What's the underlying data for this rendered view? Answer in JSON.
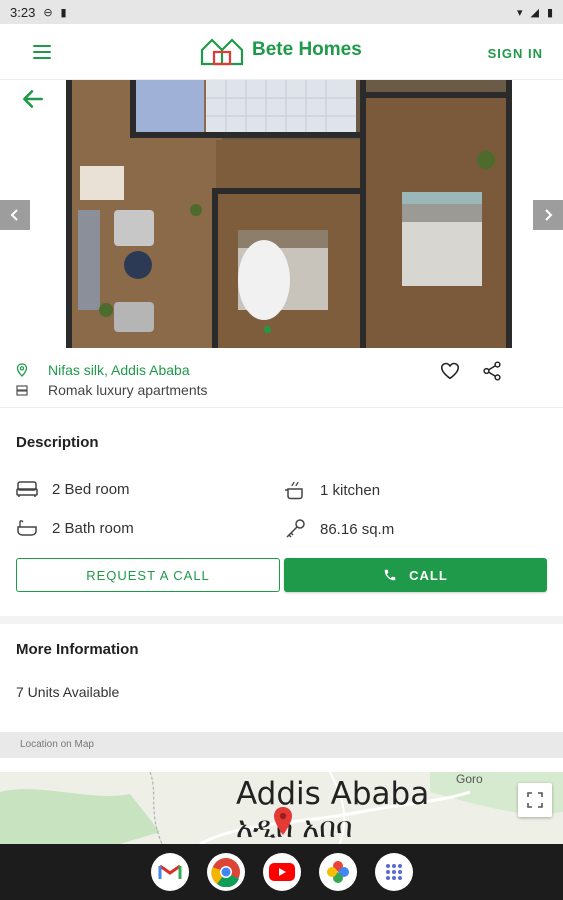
{
  "status_bar": {
    "time": "3:23"
  },
  "app": {
    "brand": "Bete Homes",
    "sign_in": "SIGN IN"
  },
  "listing": {
    "location": "Nifas silk, Addis Ababa",
    "building": "Romak luxury apartments"
  },
  "description": {
    "title": "Description",
    "bedrooms": "2 Bed room",
    "kitchen": "1 kitchen",
    "bathrooms": "2 Bath room",
    "area": "86.16 sq.m",
    "request_call": "REQUEST A CALL",
    "call": "CALL"
  },
  "more_info": {
    "title": "More Information",
    "units": "7 Units Available"
  },
  "map": {
    "label": "Location on Map",
    "city": "Addis Ababa",
    "city_amharic": "አዲስ አበባ",
    "place": "Goro"
  },
  "colors": {
    "accent": "#1f9a4a",
    "marker": "#e53935"
  },
  "taskbar_apps": [
    "gmail-icon",
    "chrome-icon",
    "youtube-icon",
    "photos-icon",
    "app-drawer-icon"
  ]
}
